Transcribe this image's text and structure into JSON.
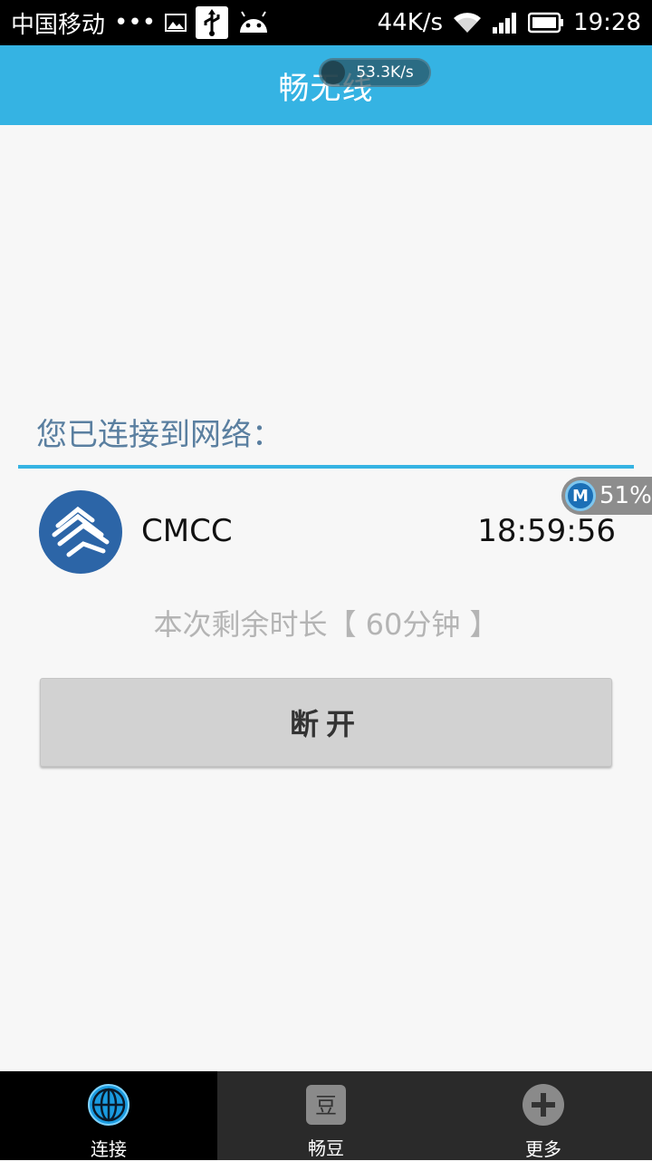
{
  "status_bar": {
    "carrier": "中国移动",
    "dots": "•••",
    "net_speed": "44K/s",
    "time": "19:28"
  },
  "header": {
    "title": "畅无线",
    "speed_overlay": "53.3K/s"
  },
  "connection": {
    "label": "您已连接到网络：",
    "network_name": "CMCC",
    "connected_time": "18:59:56",
    "remaining": "本次剩余时长【 60分钟 】",
    "disconnect_button": "断开"
  },
  "overlay_badge": {
    "percent": "51%"
  },
  "bottom_nav": {
    "items": [
      {
        "label": "连接",
        "icon": "globe-icon",
        "active": true
      },
      {
        "label": "畅豆",
        "icon": "bean-icon",
        "active": false
      },
      {
        "label": "更多",
        "icon": "plus-icon",
        "active": false
      }
    ]
  },
  "colors": {
    "accent": "#35b3e3",
    "background": "#f7f7f7",
    "nav_background": "#2a2a2a"
  }
}
